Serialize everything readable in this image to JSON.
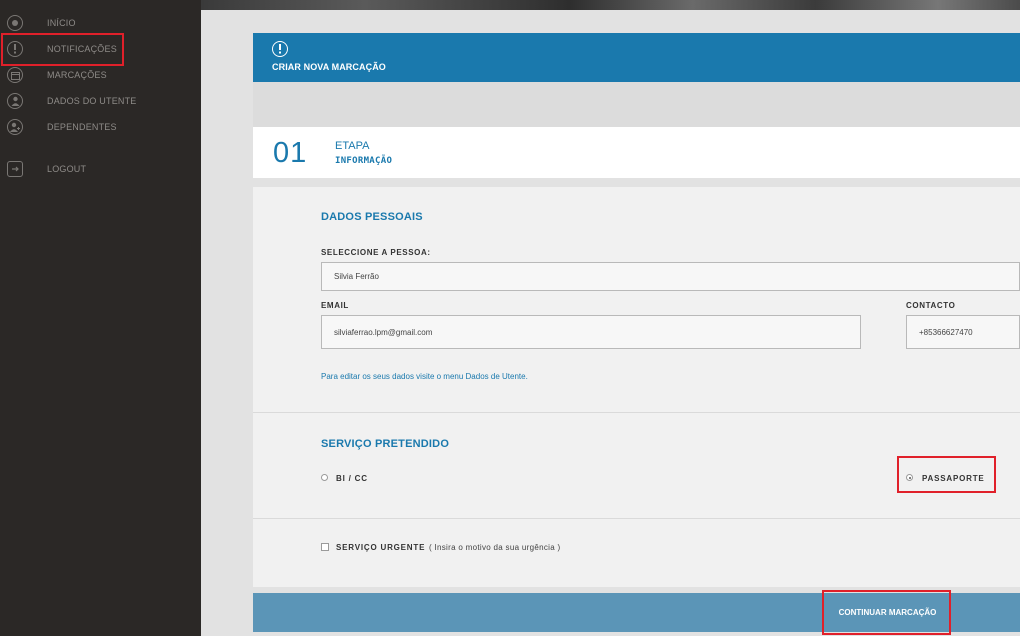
{
  "sidebar": {
    "items": [
      {
        "label": "INÍCIO",
        "icon": "circle-dot-icon"
      },
      {
        "label": "NOTIFICAÇÕES",
        "icon": "alert-icon"
      },
      {
        "label": "MARCAÇÕES",
        "icon": "calendar-icon"
      },
      {
        "label": "DADOS DO UTENTE",
        "icon": "user-icon"
      },
      {
        "label": "DEPENDENTES",
        "icon": "user-plus-icon"
      },
      {
        "label": "LOGOUT",
        "icon": "logout-icon"
      }
    ]
  },
  "header": {
    "title": "CRIAR NOVA MARCAÇÃO"
  },
  "step": {
    "number": "01",
    "title": "ETAPA",
    "subtitle": "INFORMAÇÃO"
  },
  "personal": {
    "title": "DADOS PESSOAIS",
    "person_label": "SELECCIONE A PESSOA:",
    "person_value": "Silvia Ferrão",
    "email_label": "EMAIL",
    "email_value": "silviaferrao.lpm@gmail.com",
    "contact_label": "CONTACTO",
    "contact_value": "+85366627470",
    "hint": "Para editar os seus dados visite o menu Dados de Utente."
  },
  "service": {
    "title": "SERVIÇO PRETENDIDO",
    "options": [
      {
        "label": "BI / CC",
        "checked": false
      },
      {
        "label": "PASSAPORTE",
        "checked": true
      }
    ]
  },
  "urgent": {
    "label": "SERVIÇO URGENTE",
    "hint": "( Insira o motivo da sua urgência )",
    "checked": false
  },
  "actions": {
    "continue_label": "CONTINUAR MARCAÇÃO"
  },
  "colors": {
    "accent": "#1a79ad",
    "sidebar_bg": "#2b2826",
    "highlight": "#e0202a"
  }
}
